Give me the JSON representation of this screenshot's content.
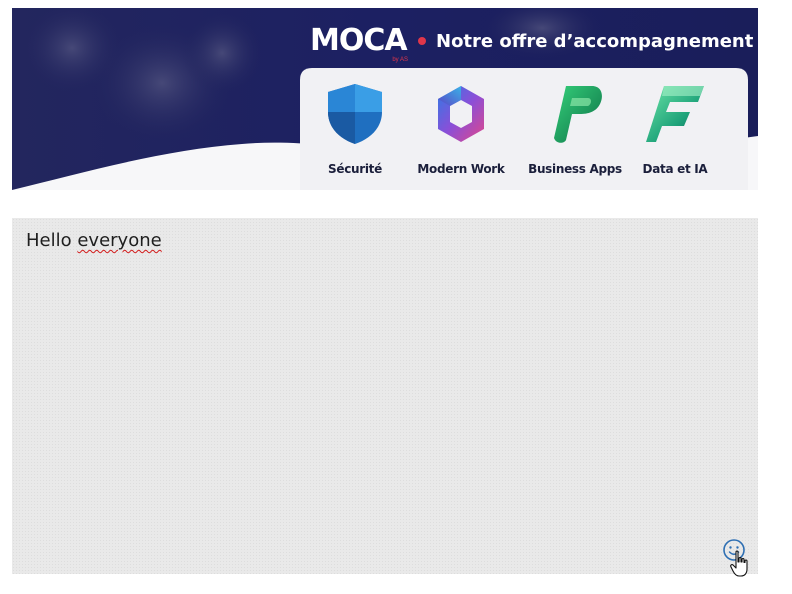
{
  "banner": {
    "brand_name": "MOCA",
    "brand_sub": "by AS",
    "tagline": "Notre offre d’accompagnement",
    "offers": [
      {
        "label": "Sécurité",
        "icon": "shield-icon"
      },
      {
        "label": "Modern Work",
        "icon": "microsoft-365-icon"
      },
      {
        "label": "Business Apps",
        "icon": "power-platform-icon"
      },
      {
        "label": "Data et IA",
        "icon": "fabric-icon"
      }
    ],
    "colors": {
      "navy": "#1b1f5c",
      "accent": "#e0364a"
    }
  },
  "editor": {
    "text_before": "Hello ",
    "text_misspelled": "everyone",
    "emoji_button": "emoji-icon"
  }
}
